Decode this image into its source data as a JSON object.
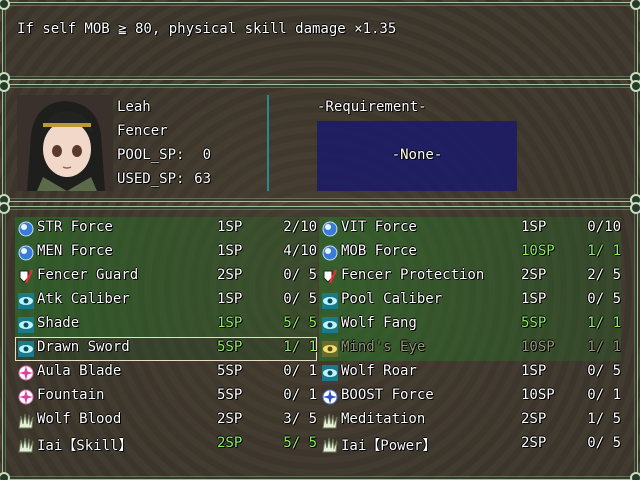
{
  "help": {
    "text": "If self MOB ≧ 80, physical skill damage ×1.35"
  },
  "status": {
    "name": "Leah",
    "class": "Fencer",
    "pool_sp_label": "POOL_SP:",
    "pool_sp": "0",
    "used_sp_label": "USED_SP:",
    "used_sp": "63",
    "requirement_title": "-Requirement-",
    "requirement_value": "-None-"
  },
  "colors": {
    "learned_text": "#8cf060",
    "disabled_text": "#9a9a7a",
    "requirement_box": "#1a1a6a"
  },
  "skills": [
    {
      "name": "STR Force",
      "sp": "1SP",
      "level": "2/10",
      "icon": "blue-orb-icon",
      "learned": false,
      "highlight": true
    },
    {
      "name": "VIT Force",
      "sp": "1SP",
      "level": "0/10",
      "icon": "blue-orb-icon",
      "learned": false,
      "highlight": true
    },
    {
      "name": "MEN Force",
      "sp": "1SP",
      "level": "4/10",
      "icon": "blue-orb-icon",
      "learned": false,
      "highlight": true
    },
    {
      "name": "MOB Force",
      "sp": "10SP",
      "level": "1/ 1",
      "icon": "blue-orb-icon",
      "learned": true,
      "highlight": true
    },
    {
      "name": "Fencer Guard",
      "sp": "2SP",
      "level": "0/ 5",
      "icon": "shield-sword-icon",
      "learned": false,
      "highlight": true
    },
    {
      "name": "Fencer Protection",
      "sp": "2SP",
      "level": "2/ 5",
      "icon": "shield-sword-icon",
      "learned": false,
      "highlight": true
    },
    {
      "name": "Atk Caliber",
      "sp": "1SP",
      "level": "0/ 5",
      "icon": "eye-icon",
      "learned": false,
      "highlight": true
    },
    {
      "name": "Pool Caliber",
      "sp": "1SP",
      "level": "0/ 5",
      "icon": "eye-icon",
      "learned": false,
      "highlight": true
    },
    {
      "name": "Shade",
      "sp": "1SP",
      "level": "5/ 5",
      "icon": "eye-icon",
      "learned": true,
      "highlight": true
    },
    {
      "name": "Wolf Fang",
      "sp": "5SP",
      "level": "1/ 1",
      "icon": "eye-icon",
      "learned": true,
      "highlight": true
    },
    {
      "name": "Drawn Sword",
      "sp": "5SP",
      "level": "1/ 1",
      "icon": "eye-icon",
      "learned": true,
      "highlight": true,
      "selected": true
    },
    {
      "name": "Mind's Eye",
      "sp": "10SP",
      "level": "1/ 1",
      "icon": "yellow-eye-icon",
      "learned": true,
      "highlight": true,
      "disabled": true
    },
    {
      "name": "Aula Blade",
      "sp": "5SP",
      "level": "0/ 1",
      "icon": "pink-star-icon",
      "learned": false,
      "highlight": false
    },
    {
      "name": "Wolf Roar",
      "sp": "1SP",
      "level": "0/ 5",
      "icon": "eye-icon",
      "learned": false,
      "highlight": false
    },
    {
      "name": "Fountain",
      "sp": "5SP",
      "level": "0/ 1",
      "icon": "pink-star-icon",
      "learned": false,
      "highlight": false
    },
    {
      "name": "BOOST Force",
      "sp": "10SP",
      "level": "0/ 1",
      "icon": "blue-star-icon",
      "learned": false,
      "highlight": false
    },
    {
      "name": "Wolf Blood",
      "sp": "2SP",
      "level": "3/ 5",
      "icon": "claw-icon",
      "learned": false,
      "highlight": false
    },
    {
      "name": "Meditation",
      "sp": "2SP",
      "level": "1/ 5",
      "icon": "claw-icon",
      "learned": false,
      "highlight": false
    },
    {
      "name": "Iai【Skill】",
      "sp": "2SP",
      "level": "5/ 5",
      "icon": "claw-icon",
      "learned": true,
      "highlight": false
    },
    {
      "name": "Iai【Power】",
      "sp": "2SP",
      "level": "0/ 5",
      "icon": "claw-icon",
      "learned": false,
      "highlight": false
    }
  ]
}
